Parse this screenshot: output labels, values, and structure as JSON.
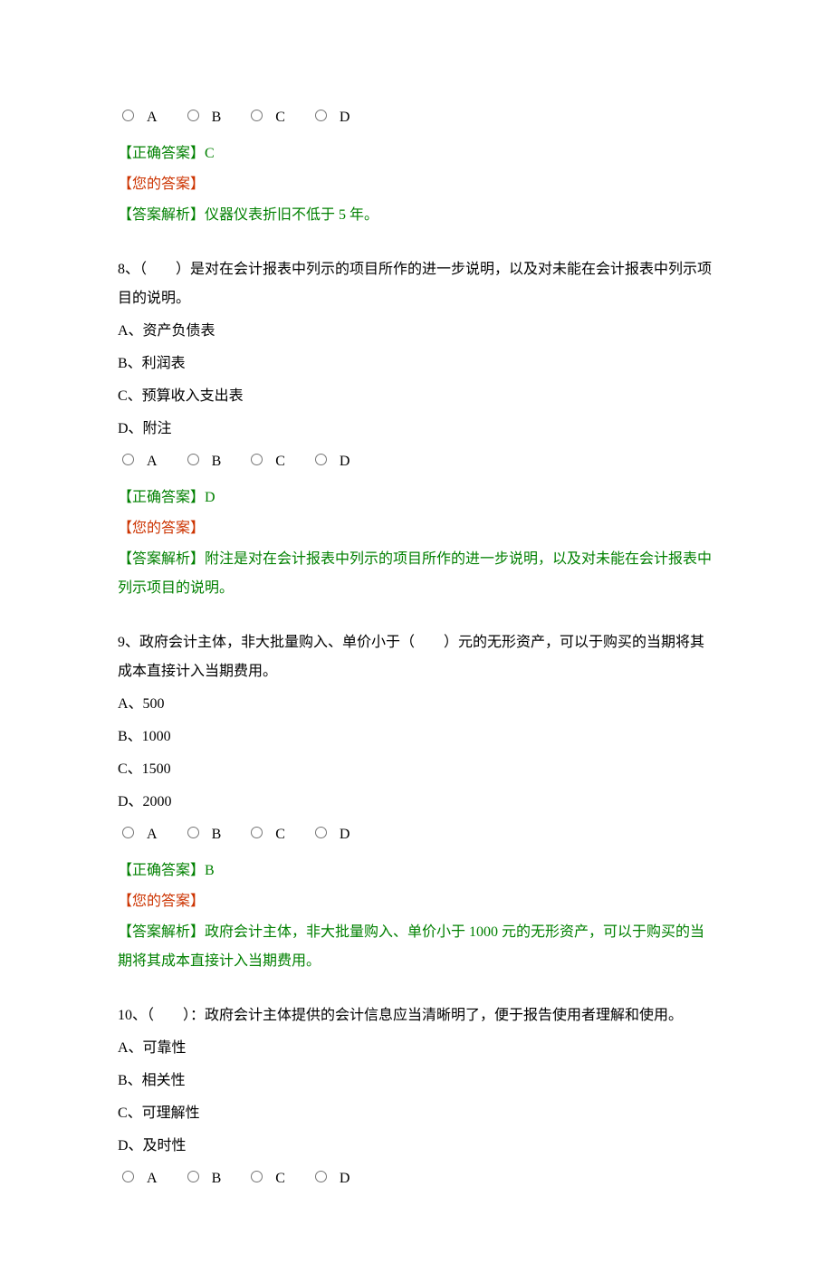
{
  "labels": {
    "correct_answer_prefix": "【正确答案】",
    "your_answer": "【您的答案】",
    "explanation_prefix": "【答案解析】"
  },
  "radio_options": [
    "A",
    "B",
    "C",
    "D"
  ],
  "questions": [
    {
      "number": "",
      "stem": "",
      "options": [],
      "correct": "C",
      "explanation": "仪器仪表折旧不低于 5 年。"
    },
    {
      "number": "8、",
      "stem": "（　　）是对在会计报表中列示的项目所作的进一步说明，以及对未能在会计报表中列示项目的说明。",
      "options": [
        "A、资产负债表",
        "B、利润表",
        "C、预算收入支出表",
        "D、附注"
      ],
      "correct": "D",
      "explanation": "附注是对在会计报表中列示的项目所作的进一步说明，以及对未能在会计报表中列示项目的说明。"
    },
    {
      "number": "9、",
      "stem": "政府会计主体，非大批量购入、单价小于（　　）元的无形资产，可以于购买的当期将其成本直接计入当期费用。",
      "options": [
        "A、500",
        "B、1000",
        "C、1500",
        "D、2000"
      ],
      "correct": "B",
      "explanation": "政府会计主体，非大批量购入、单价小于 1000 元的无形资产，可以于购买的当期将其成本直接计入当期费用。"
    },
    {
      "number": "10、",
      "stem": "（　　）：政府会计主体提供的会计信息应当清晰明了，便于报告使用者理解和使用。",
      "options": [
        "A、可靠性",
        "B、相关性",
        "C、可理解性",
        "D、及时性"
      ],
      "correct": "",
      "explanation": ""
    }
  ]
}
